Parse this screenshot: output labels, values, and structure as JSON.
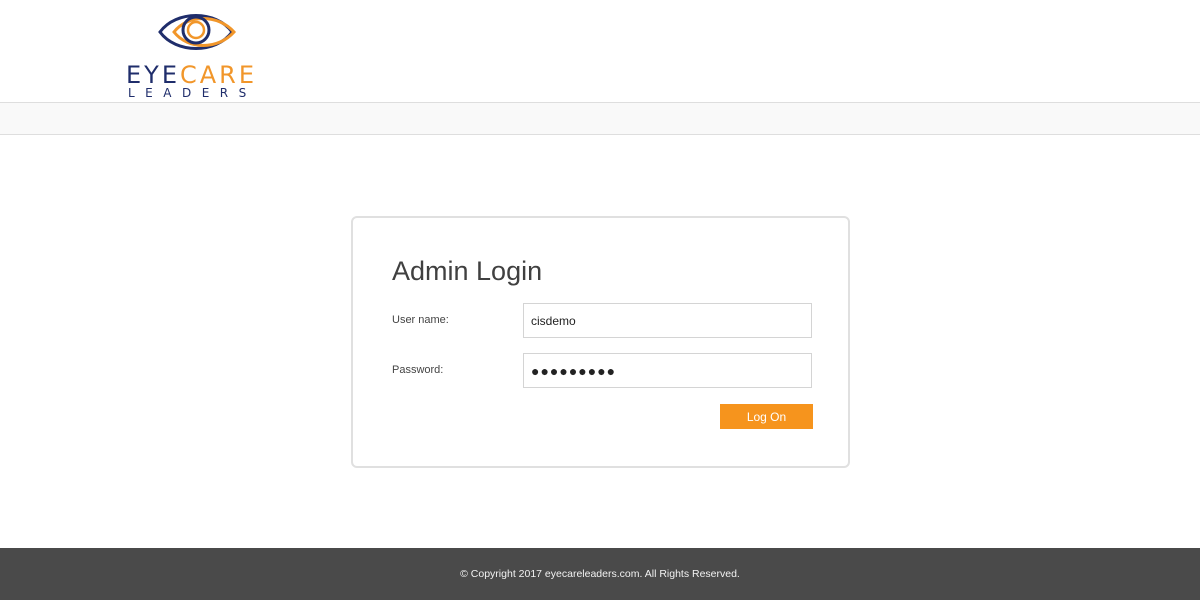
{
  "brand": {
    "word1_part1": "EYE",
    "word1_part2": "CARE",
    "word2": "LEADERS",
    "colors": {
      "navy": "#1f2d6b",
      "orange": "#f1962a"
    },
    "icon": "eye-icon"
  },
  "login": {
    "title": "Admin Login",
    "username_label": "User name:",
    "username_value": "cisdemo",
    "password_label": "Password:",
    "password_value": "●●●●●●●●●",
    "submit_label": "Log On"
  },
  "footer": {
    "text": "© Copyright 2017 eyecareleaders.com. All Rights Reserved."
  },
  "colors": {
    "accent": "#f6941d",
    "footer_bg": "#4a4a4a"
  }
}
